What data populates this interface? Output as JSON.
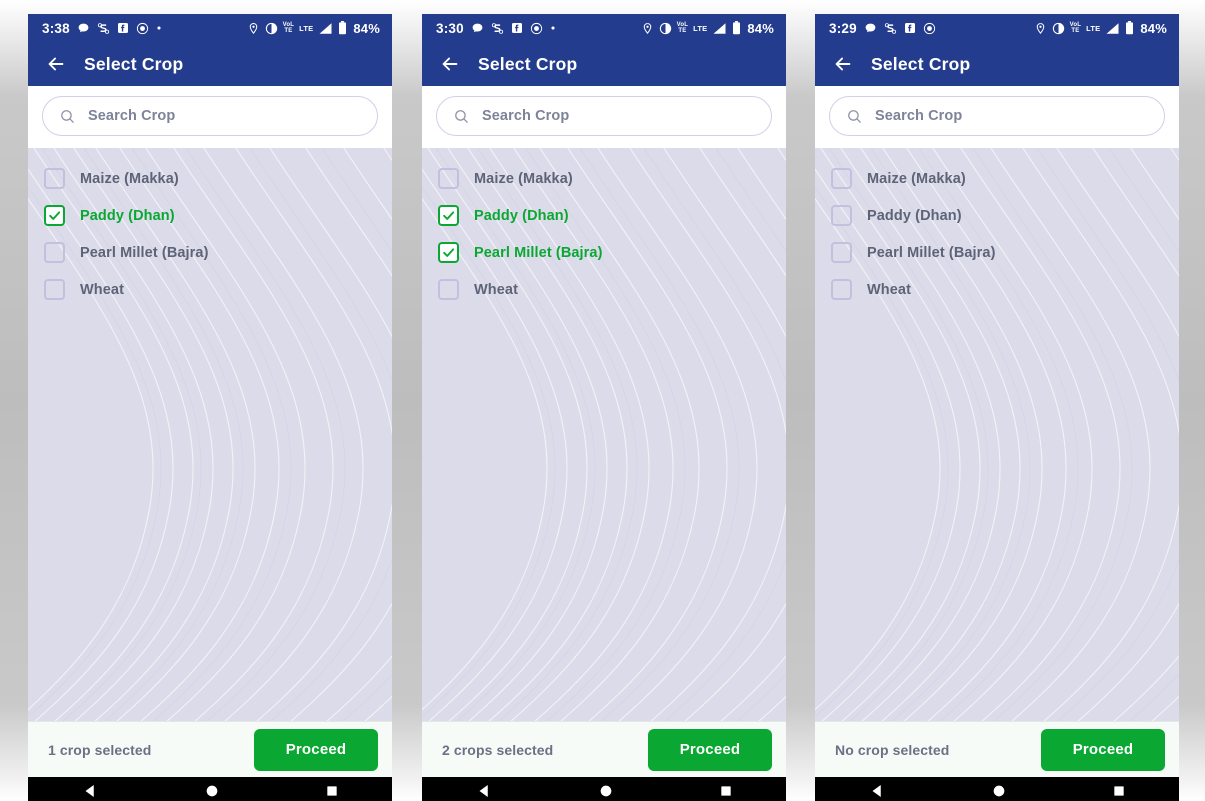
{
  "app": {
    "title": "Select Crop",
    "back_icon": "arrow-left-icon"
  },
  "search": {
    "placeholder": "Search Crop",
    "value": "",
    "icon": "search-icon"
  },
  "colors": {
    "header_blue": "#243c8d",
    "accent_green": "#0aa833",
    "list_background": "#dcdbe9",
    "checkbox_border": "#c3bfdf",
    "label_grey": "#5d6478"
  },
  "crops": [
    {
      "label": "Maize (Makka)"
    },
    {
      "label": "Paddy (Dhan)"
    },
    {
      "label": "Pearl Millet (Bajra)"
    },
    {
      "label": "Wheat"
    }
  ],
  "status_icons": {
    "location": "location-pin-icon",
    "dnd": "do-not-disturb-icon",
    "volte": "volte-icon",
    "lte": "lte-icon",
    "signal": "signal-bars-icon",
    "battery": "battery-icon",
    "message": "message-bubble-icon",
    "skype": "skype-icon",
    "facebook": "facebook-icon",
    "target": "target-icon",
    "dot": "dot-icon"
  },
  "navbar": {
    "back": "nav-back-triangle-icon",
    "home": "nav-home-circle-icon",
    "recents": "nav-recents-square-icon"
  },
  "panels": [
    {
      "id": "panel-1",
      "time": "3:38",
      "battery": "84%",
      "checked": [
        false,
        true,
        false,
        false
      ],
      "footer_count": "1 crop selected",
      "proceed_label": "Proceed",
      "has_trailing_dot": true
    },
    {
      "id": "panel-2",
      "time": "3:30",
      "battery": "84%",
      "checked": [
        false,
        true,
        true,
        false
      ],
      "footer_count": "2 crops selected",
      "proceed_label": "Proceed",
      "has_trailing_dot": true
    },
    {
      "id": "panel-3",
      "time": "3:29",
      "battery": "84%",
      "checked": [
        false,
        false,
        false,
        false
      ],
      "footer_count": "No crop selected",
      "proceed_label": "Proceed",
      "has_trailing_dot": false
    }
  ]
}
